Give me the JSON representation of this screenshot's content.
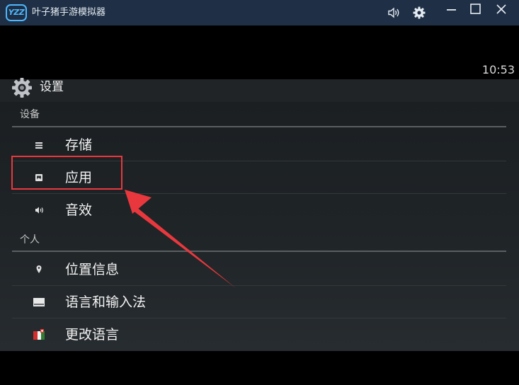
{
  "window": {
    "logo_text": "YZZ",
    "title": "叶子猪手游模拟器",
    "controls": [
      "volume-icon",
      "gear-icon",
      "minimize-icon",
      "maximize-icon",
      "close-icon"
    ]
  },
  "status_bar": {
    "time": "10:53"
  },
  "settings": {
    "title": "设置",
    "sections": [
      {
        "header": "设备",
        "items": [
          {
            "label": "存储",
            "icon": "storage-icon"
          },
          {
            "label": "应用",
            "icon": "apps-icon"
          },
          {
            "label": "音效",
            "icon": "sound-icon"
          }
        ]
      },
      {
        "header": "个人",
        "items": [
          {
            "label": "位置信息",
            "icon": "location-icon"
          },
          {
            "label": "语言和输入法",
            "icon": "keyboard-icon"
          },
          {
            "label": "更改语言",
            "icon": "language-flag-icon"
          }
        ]
      }
    ]
  },
  "annotation": {
    "highlighted_item": "应用",
    "color": "#e8383d"
  },
  "colors": {
    "titlebar": "#1f2f45",
    "accent": "#4db8ff",
    "background": "#000000"
  }
}
